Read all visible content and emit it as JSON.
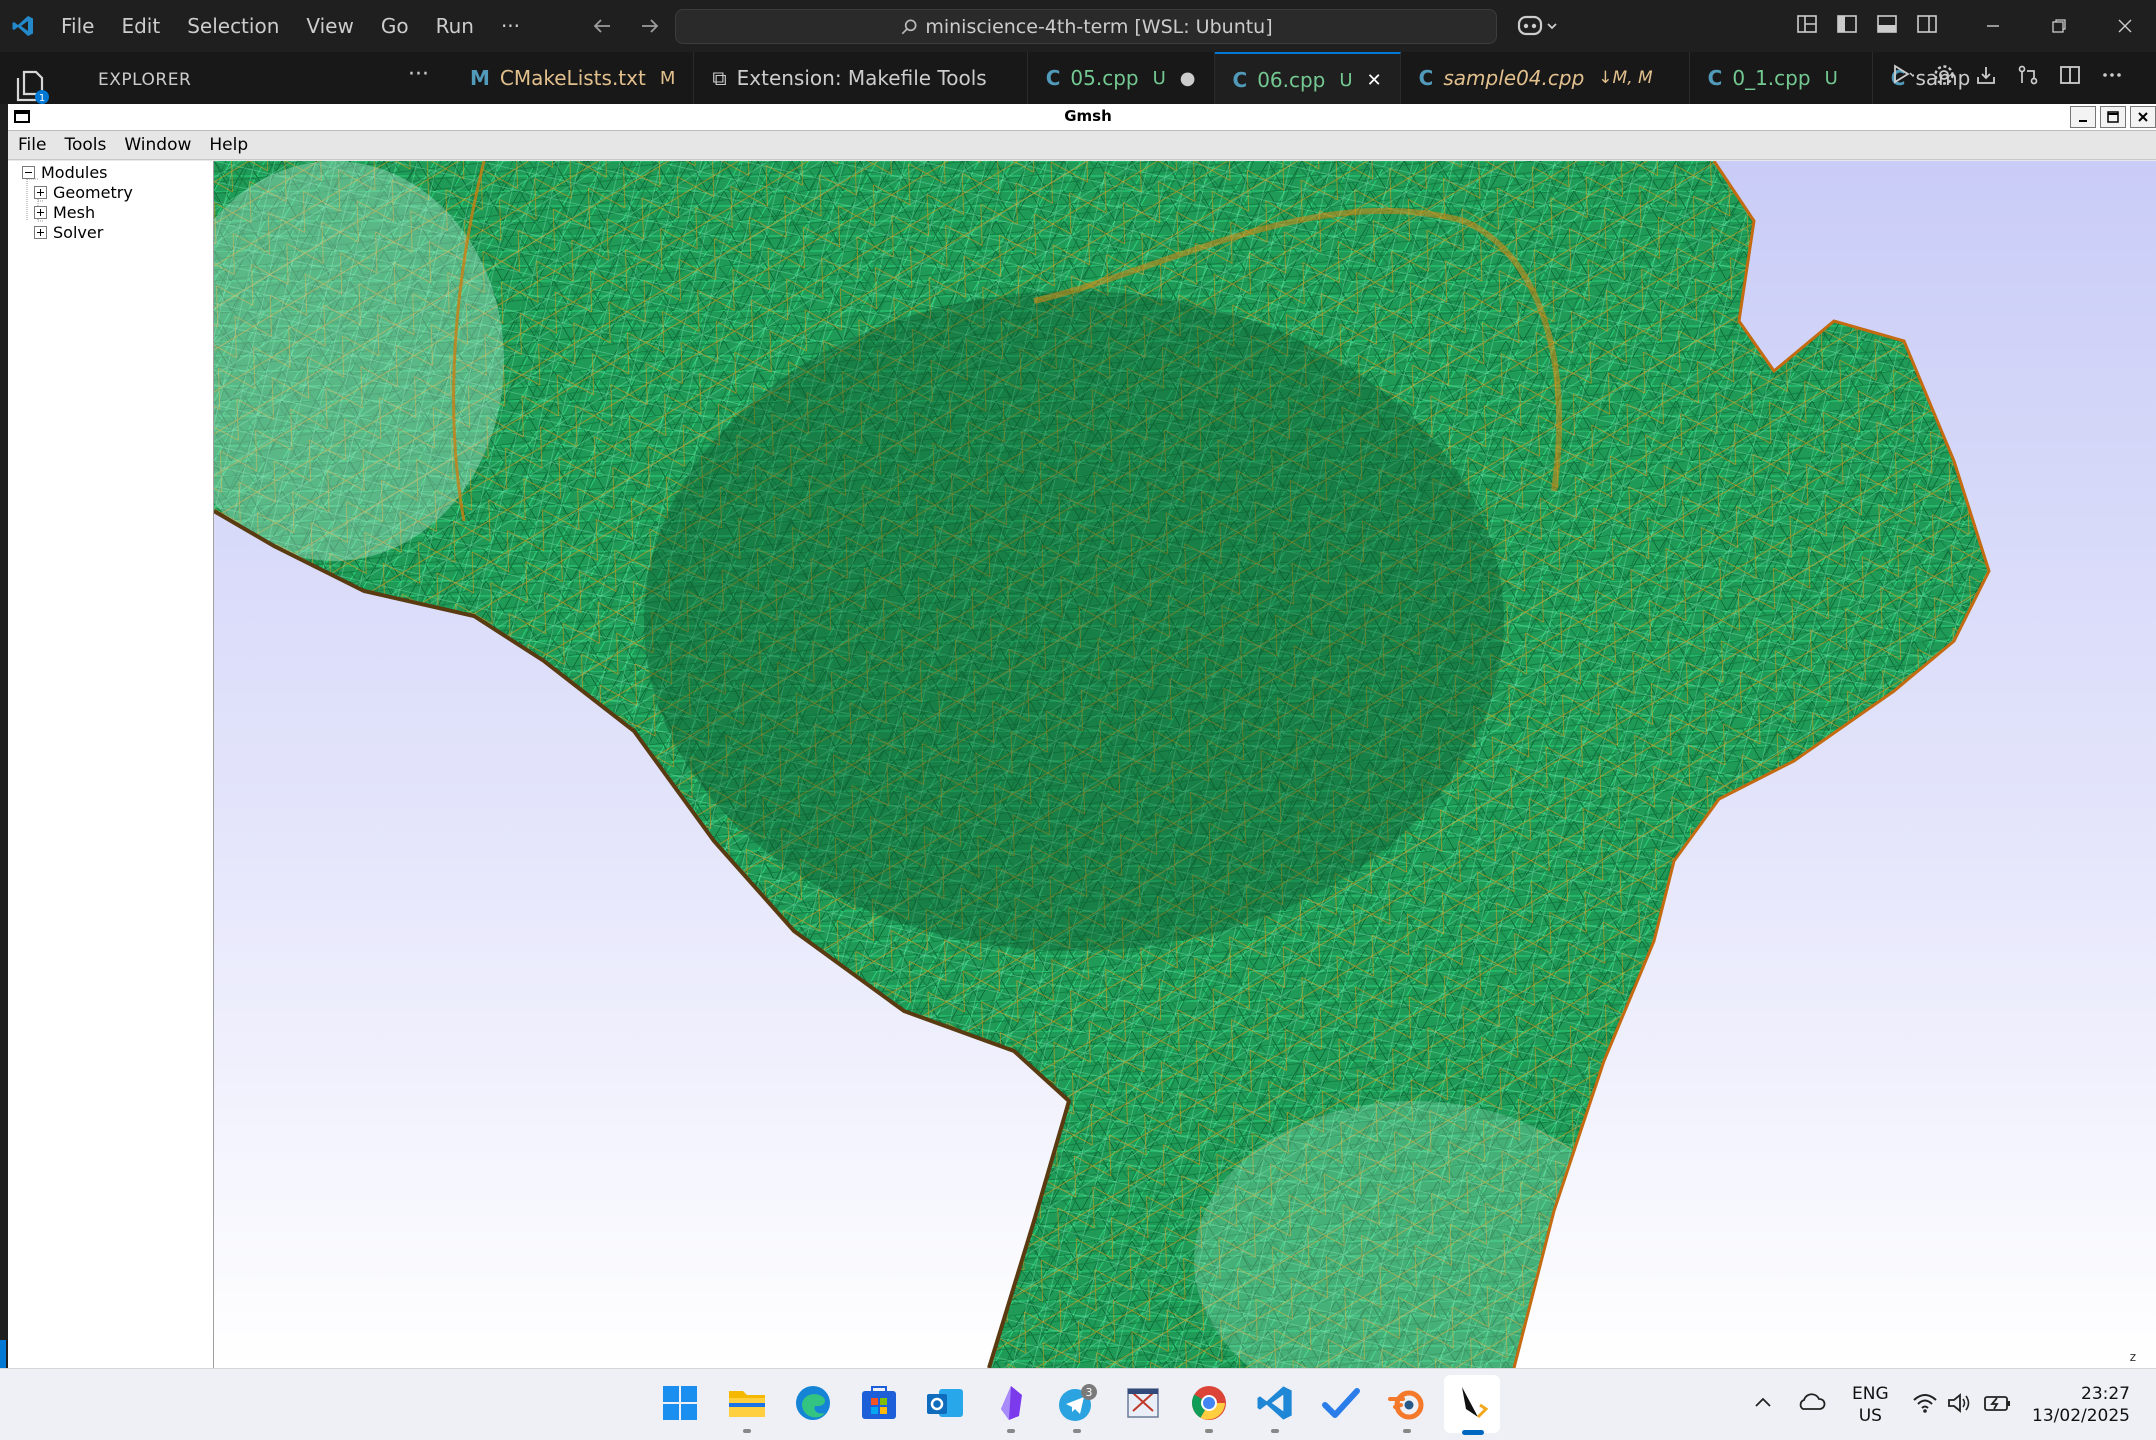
{
  "vscode": {
    "menu": [
      "File",
      "Edit",
      "Selection",
      "View",
      "Go",
      "Run",
      "···"
    ],
    "command_center": "miniscience-4th-term [WSL: Ubuntu]",
    "explorer_title": "EXPLORER",
    "explorer_more": "···",
    "activity_badge": "1",
    "tabs": [
      {
        "icon": "M",
        "label": "CMakeLists.txt",
        "badge": "M",
        "color": "#e2c08d",
        "icon_color": "#519aba"
      },
      {
        "icon": "⧉",
        "label": "Extension: Makefile Tools",
        "badge": "",
        "color": "#cccccc",
        "icon_color": "#cccccc"
      },
      {
        "icon": "C",
        "label": "05.cpp",
        "badge": "U",
        "color": "#73c991",
        "icon_color": "#519aba",
        "dirty": "●"
      },
      {
        "icon": "C",
        "label": "06.cpp",
        "badge": "U",
        "color": "#73c991",
        "icon_color": "#519aba",
        "close": "✕"
      },
      {
        "icon": "C",
        "label": "sample04.cpp",
        "badge": "↓M, M",
        "color": "#e2c08d",
        "icon_color": "#519aba"
      },
      {
        "icon": "C",
        "label": "0_1.cpp",
        "badge": "U",
        "color": "#73c991",
        "icon_color": "#519aba"
      },
      {
        "icon": "C",
        "label": "samp",
        "badge": "",
        "color": "#cccccc",
        "icon_color": "#519aba"
      }
    ]
  },
  "gmsh": {
    "title": "Gmsh",
    "menu": [
      "File",
      "Tools",
      "Window",
      "Help"
    ],
    "tree": {
      "root": "Modules",
      "children": [
        "Geometry",
        "Mesh",
        "Solver"
      ]
    },
    "axis_label": "z",
    "mesh_colors": {
      "edge_dark": "#7a4a12",
      "edge_orange": "#e08a10",
      "fill_green": "#1f9a57",
      "line_green": "#2bd07a"
    }
  },
  "taskbar": {
    "icons": [
      "windows-start-icon",
      "file-explorer-icon",
      "edge-icon",
      "store-icon",
      "outlook-icon",
      "obsidian-icon",
      "telegram-icon",
      "snipping-icon",
      "chrome-icon",
      "vscode-icon",
      "todo-icon",
      "blender-icon",
      "gmsh-icon"
    ],
    "telegram_badge": "3",
    "language": [
      "ENG",
      "US"
    ],
    "time": "23:27",
    "date": "13/02/2025"
  }
}
